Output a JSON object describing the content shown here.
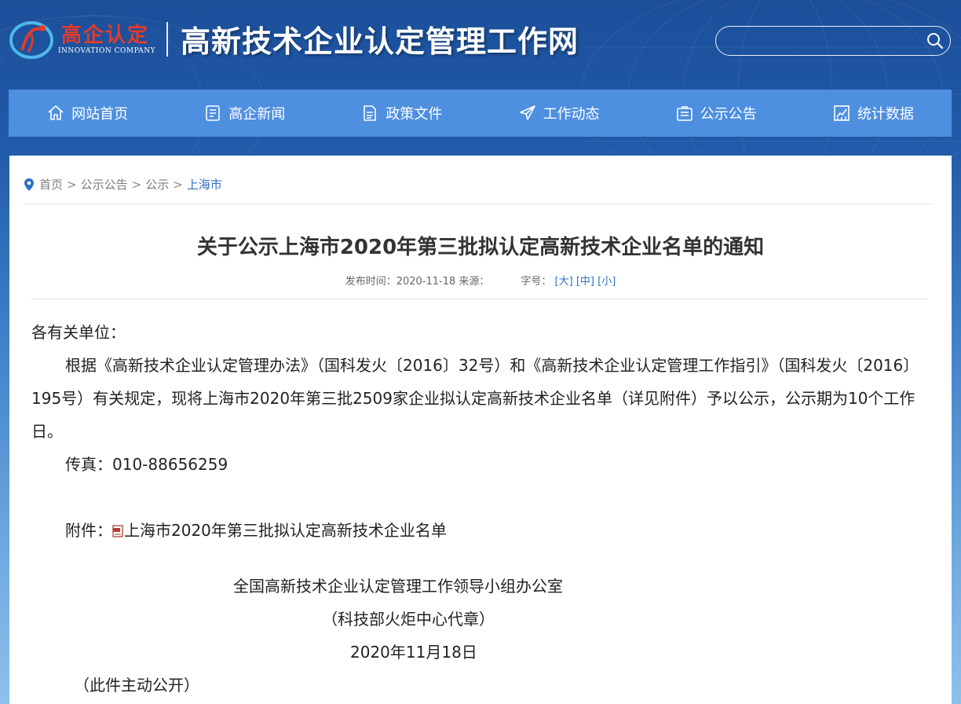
{
  "header": {
    "logo_cn": "高企认定",
    "logo_en": "INNOVATION COMPANY",
    "site_title": "高新技术企业认定管理工作网",
    "search_placeholder": ""
  },
  "nav": {
    "items": [
      {
        "label": "网站首页",
        "icon": "home-icon"
      },
      {
        "label": "高企新闻",
        "icon": "news-icon"
      },
      {
        "label": "政策文件",
        "icon": "document-icon"
      },
      {
        "label": "工作动态",
        "icon": "send-icon"
      },
      {
        "label": "公示公告",
        "icon": "notice-icon"
      },
      {
        "label": "统计数据",
        "icon": "chart-icon"
      }
    ]
  },
  "breadcrumb": {
    "items": [
      "首页",
      "公示公告",
      "公示"
    ],
    "separator": ">",
    "current": "上海市"
  },
  "article": {
    "title": "关于公示上海市2020年第三批拟认定高新技术企业名单的通知",
    "meta_published": "发布时间：2020-11-18 来源：",
    "meta_fontsize_label": "字号：",
    "font_large": "[大]",
    "font_medium": "[中]",
    "font_small": "[小]",
    "salutation": "各有关单位：",
    "paragraph": "根据《高新技术企业认定管理办法》（国科发火〔2016〕32号）和《高新技术企业认定管理工作指引》（国科发火〔2016〕195号）有关规定，现将上海市2020年第三批2509家企业拟认定高新技术企业名单（详见附件）予以公示，公示期为10个工作日。",
    "fax": "传真：010-88656259",
    "attachment_label": "附件：",
    "attachment_link": "上海市2020年第三批拟认定高新技术企业名单",
    "signature_org": "全国高新技术企业认定管理工作领导小组办公室",
    "signature_sub": "（科技部火炬中心代章）",
    "signature_date": "2020年11月18日",
    "disclosure": "（此件主动公开）"
  },
  "colors": {
    "nav_bg": "#4e8fe0",
    "logo_red": "#e23b2c",
    "link_blue": "#2f6fc4"
  }
}
